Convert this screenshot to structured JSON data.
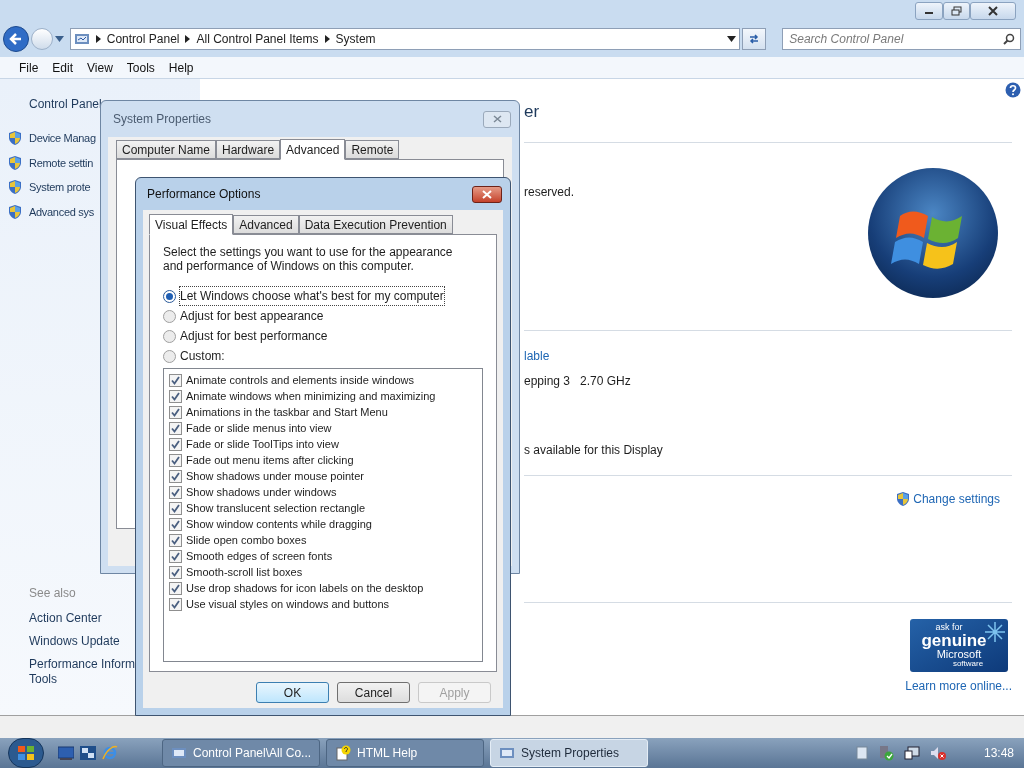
{
  "address_bar": {
    "breadcrumbs": [
      "Control Panel",
      "All Control Panel Items",
      "System"
    ],
    "search": {
      "placeholder": "Search Control Panel"
    }
  },
  "menu": [
    "File",
    "Edit",
    "View",
    "Tools",
    "Help"
  ],
  "sidebar": {
    "home": "Control Panel",
    "tasks": [
      "Device Manag",
      "Remote settin",
      "System prote",
      "Advanced sys"
    ],
    "see_also_heading": "See also",
    "see_also": [
      {
        "lines": [
          "Action Center"
        ]
      },
      {
        "lines": [
          "Windows Update"
        ]
      },
      {
        "lines": [
          "Performance Inform",
          "Tools"
        ]
      }
    ]
  },
  "main": {
    "title": "er",
    "copyright": "reserved.",
    "rating_link": "lable",
    "processor": "epping 3   2.70 GHz",
    "pen_touch": "s available for this Display",
    "change_settings": "Change settings",
    "genuine_badge": [
      "ask for",
      "genuine",
      "Microsoft",
      "software"
    ],
    "learn_more": "Learn more online..."
  },
  "system_properties": {
    "title": "System Properties",
    "tabs": [
      {
        "label": "Computer Name",
        "selected": false
      },
      {
        "label": "Hardware",
        "selected": false
      },
      {
        "label": "Advanced",
        "selected": true
      },
      {
        "label": "Remote",
        "selected": false
      }
    ]
  },
  "performance_options": {
    "title": "Performance Options",
    "tabs": [
      {
        "label": "Visual Effects",
        "selected": true
      },
      {
        "label": "Advanced",
        "selected": false
      },
      {
        "label": "Data Execution Prevention",
        "selected": false
      }
    ],
    "description": "Select the settings you want to use for the appearance and performance of Windows on this computer.",
    "radios": [
      {
        "label": "Let Windows choose what's best for my computer",
        "selected": true
      },
      {
        "label": "Adjust for best appearance",
        "selected": false
      },
      {
        "label": "Adjust for best performance",
        "selected": false
      },
      {
        "label": "Custom:",
        "selected": false
      }
    ],
    "effects": [
      {
        "label": "Animate controls and elements inside windows",
        "checked": true
      },
      {
        "label": "Animate windows when minimizing and maximizing",
        "checked": true
      },
      {
        "label": "Animations in the taskbar and Start Menu",
        "checked": true
      },
      {
        "label": "Fade or slide menus into view",
        "checked": true
      },
      {
        "label": "Fade or slide ToolTips into view",
        "checked": true
      },
      {
        "label": "Fade out menu items after clicking",
        "checked": true
      },
      {
        "label": "Show shadows under mouse pointer",
        "checked": true
      },
      {
        "label": "Show shadows under windows",
        "checked": true
      },
      {
        "label": "Show translucent selection rectangle",
        "checked": true
      },
      {
        "label": "Show window contents while dragging",
        "checked": true
      },
      {
        "label": "Slide open combo boxes",
        "checked": true
      },
      {
        "label": "Smooth edges of screen fonts",
        "checked": true
      },
      {
        "label": "Smooth-scroll list boxes",
        "checked": true
      },
      {
        "label": "Use drop shadows for icon labels on the desktop",
        "checked": true
      },
      {
        "label": "Use visual styles on windows and buttons",
        "checked": true
      }
    ],
    "buttons": [
      {
        "label": "OK",
        "default": true,
        "disabled": false
      },
      {
        "label": "Cancel",
        "default": false,
        "disabled": false
      },
      {
        "label": "Apply",
        "default": false,
        "disabled": true
      }
    ]
  },
  "taskbar": {
    "tasks": [
      {
        "label": "Control Panel\\All Co...",
        "selected": false
      },
      {
        "label": "HTML Help",
        "selected": false
      },
      {
        "label": "System Properties",
        "selected": true
      }
    ],
    "clock": "13:48"
  }
}
